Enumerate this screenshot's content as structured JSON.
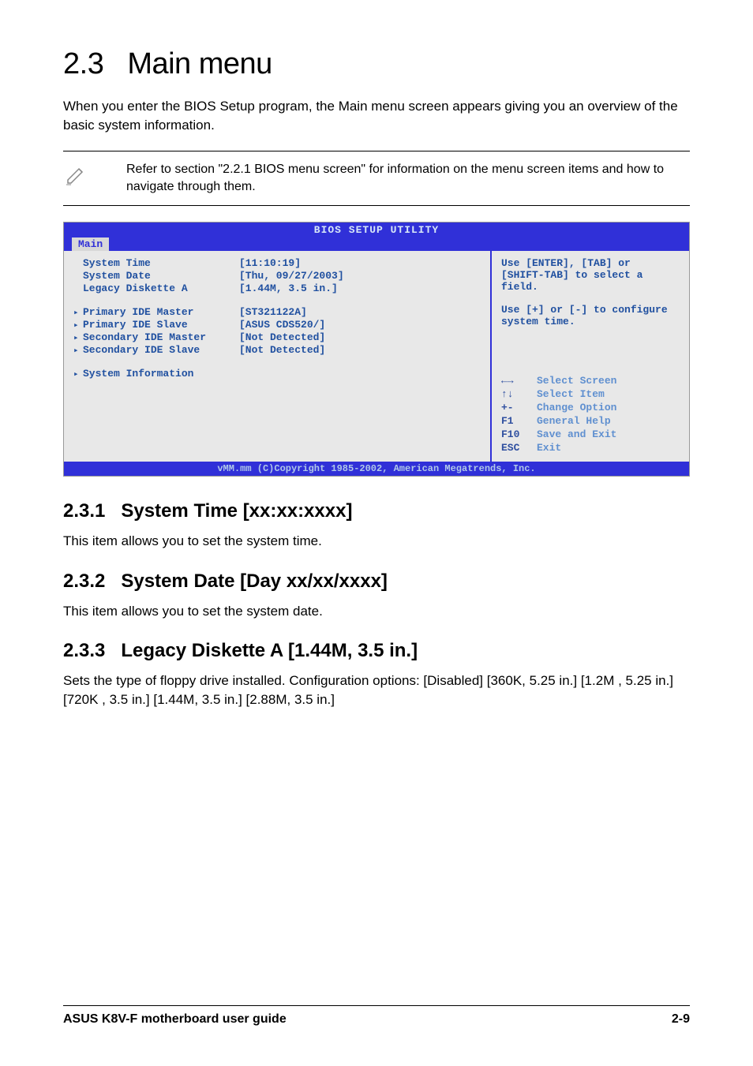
{
  "heading": {
    "number": "2.3",
    "title": "Main menu"
  },
  "intro": "When you enter the BIOS Setup program, the Main menu screen appears giving you an overview of the basic system information.",
  "note": "Refer to section \"2.2.1  BIOS menu screen\" for information on the menu screen items and how to navigate through them.",
  "bios": {
    "title": "BIOS SETUP UTILITY",
    "tab": "Main",
    "items": [
      {
        "label": "System Time",
        "value": "[11:10:19]",
        "pointer": false
      },
      {
        "label": "System Date",
        "value": "[Thu, 09/27/2003]",
        "pointer": false
      },
      {
        "label": "Legacy Diskette A",
        "value": "[1.44M, 3.5 in.]",
        "pointer": false
      }
    ],
    "items2": [
      {
        "label": "Primary IDE Master",
        "value": "[ST321122A]",
        "pointer": true
      },
      {
        "label": "Primary IDE Slave",
        "value": "[ASUS CDS520/]",
        "pointer": true
      },
      {
        "label": "Secondary IDE Master",
        "value": "[Not Detected]",
        "pointer": true
      },
      {
        "label": "Secondary IDE Slave",
        "value": "[Not Detected]",
        "pointer": true
      }
    ],
    "items3": [
      {
        "label": "System Information",
        "value": "",
        "pointer": true
      }
    ],
    "help1": "Use [ENTER], [TAB] or [SHIFT-TAB] to select a field.",
    "help2": "Use [+] or [-] to configure system time.",
    "keys": [
      {
        "key": "←→",
        "action": "Select Screen"
      },
      {
        "key": "↑↓",
        "action": "Select Item"
      },
      {
        "key": "+-",
        "action": "Change Option"
      },
      {
        "key": "F1",
        "action": "General Help"
      },
      {
        "key": "F10",
        "action": "Save and Exit"
      },
      {
        "key": "ESC",
        "action": "Exit"
      }
    ],
    "footer": "vMM.mm (C)Copyright 1985-2002, American Megatrends, Inc."
  },
  "sub1": {
    "number": "2.3.1",
    "title": "System Time [xx:xx:xxxx]",
    "text": "This item allows you to set the system time."
  },
  "sub2": {
    "number": "2.3.2",
    "title": "System Date [Day xx/xx/xxxx]",
    "text": "This item allows you to set the system date."
  },
  "sub3": {
    "number": "2.3.3",
    "title": "Legacy Diskette A [1.44M, 3.5 in.]",
    "text": "Sets the type of floppy drive installed. Configuration options: [Disabled] [360K, 5.25 in.] [1.2M , 5.25 in.] [720K , 3.5 in.] [1.44M, 3.5 in.] [2.88M, 3.5 in.]"
  },
  "footer": {
    "left": "ASUS K8V-F motherboard user guide",
    "right": "2-9"
  }
}
